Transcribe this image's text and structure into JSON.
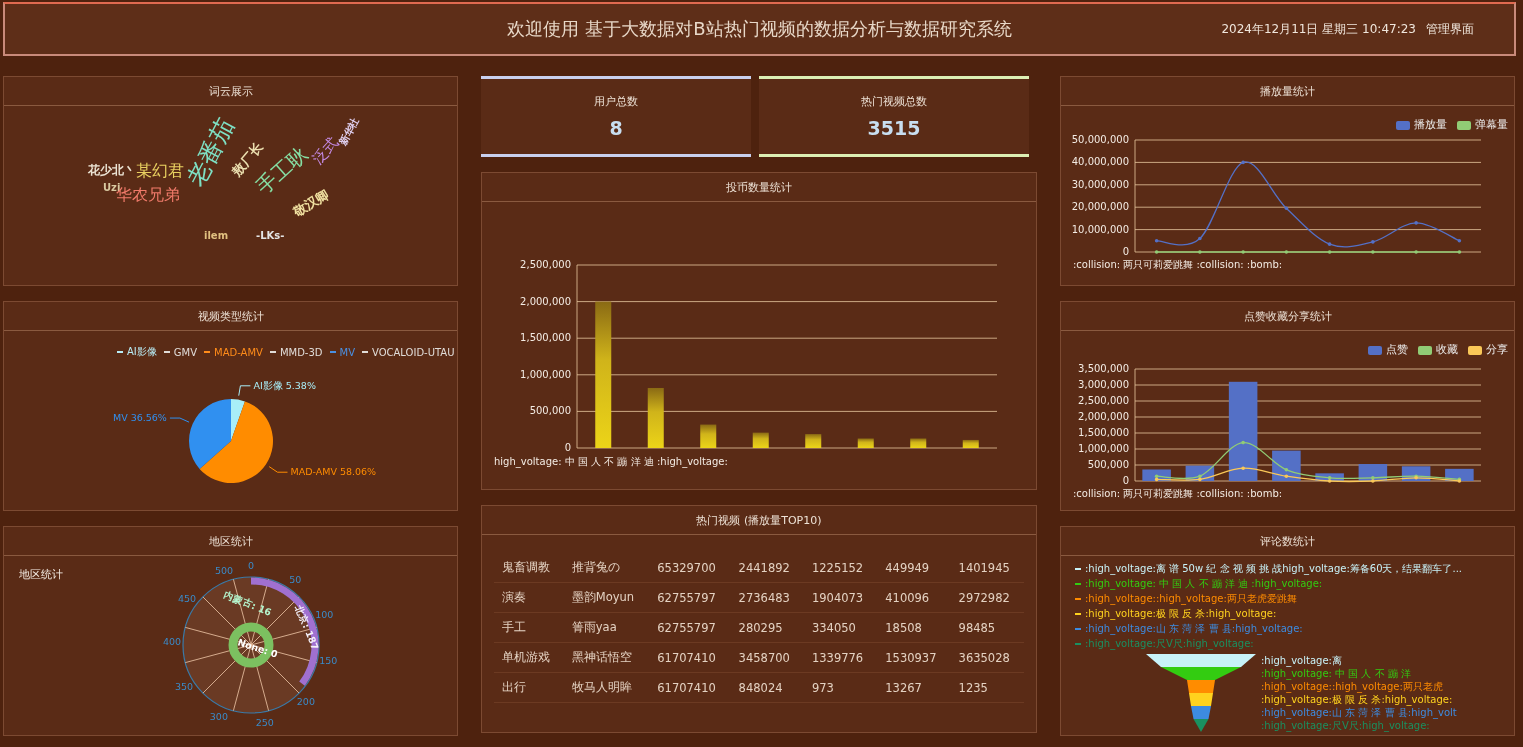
{
  "header": {
    "title": "欢迎使用 基于大数据对B站热门视频的数据分析与数据研究系统",
    "datetime": "2024年12月11日 星期三 10:47:23",
    "admin_link": "管理界面"
  },
  "word_cloud": {
    "title": "词云展示",
    "words": [
      {
        "text": "花少北丶",
        "color": "#ece4d4"
      },
      {
        "text": "Uzi",
        "color": "#d8c8a0"
      },
      {
        "text": "某幻君",
        "color": "#e8d060"
      },
      {
        "text": "华农兄弟",
        "color": "#f07a6a"
      },
      {
        "text": "老番茄",
        "color": "#7ee0c4"
      },
      {
        "text": "敖厂长",
        "color": "#ece0b0"
      },
      {
        "text": "手工耿",
        "color": "#86e0a4"
      },
      {
        "text": "泛式",
        "color": "#c48ae4"
      },
      {
        "text": "新华社",
        "color": "#e0d0f0"
      },
      {
        "text": "敬汉卿",
        "color": "#f0e0a0"
      },
      {
        "text": "ilem",
        "color": "#e0c080"
      },
      {
        "text": "-LKs-",
        "color": "#e4e4e4"
      }
    ]
  },
  "video_types": {
    "title": "视频类型统计",
    "legend": [
      {
        "label": "AI影像",
        "color": "#b8ecf5"
      },
      {
        "label": "GMV",
        "color": "#e0dcd8"
      },
      {
        "label": "MAD-AMV",
        "color": "#ff8c1a"
      },
      {
        "label": "MMD-3D",
        "color": "#e0dcd8"
      },
      {
        "label": "MV",
        "color": "#4a90e2"
      },
      {
        "label": "VOCALOID-UTAU",
        "color": "#e0dcd8"
      }
    ],
    "chart_data": {
      "type": "pie",
      "categories": [
        "AI影像",
        "MAD-AMV",
        "MV"
      ],
      "values": [
        5.38,
        58.06,
        36.56
      ],
      "colors": [
        "#a8eef8",
        "#ff8c00",
        "#3090f0"
      ],
      "value_labels": [
        "5.38%",
        "58.06%",
        "36.56%"
      ]
    }
  },
  "region": {
    "title": "地区统计",
    "chart_title": "地区统计",
    "axis_labels": [
      "0",
      "50",
      "100",
      "150",
      "200",
      "250",
      "300",
      "350",
      "400",
      "450",
      "500"
    ],
    "labels": [
      "内蒙古: 16",
      "北京: 187",
      "None: 0"
    ]
  },
  "stats": [
    {
      "label": "用户总数",
      "value": "8",
      "color": "#c9d0ee"
    },
    {
      "label": "热门视频总数",
      "value": "3515",
      "color": "#dcefb4"
    }
  ],
  "coins": {
    "title": "投币数量统计",
    "axis_caption": "high_voltage: 中 国 人 不 蹦 洋 迪 :high_voltage:",
    "chart_data": {
      "type": "bar",
      "grid": true,
      "values": [
        2000000,
        820000,
        320000,
        210000,
        190000,
        130000,
        130000,
        110000
      ],
      "ylim": [
        0,
        2500000
      ],
      "yticks": [
        0,
        {
          "value": 500000,
          "label": "500,000"
        },
        {
          "value": 1000000,
          "label": "1,000,000"
        },
        {
          "value": 1500000,
          "label": "1,500,000"
        },
        {
          "value": 2000000,
          "label": "2,000,000"
        },
        {
          "value": 2500000,
          "label": "2,500,000"
        }
      ]
    }
  },
  "hot_videos": {
    "title": "热门视频 (播放量TOP10)",
    "rows": [
      [
        "鬼畜调教",
        "推背兔の",
        "65329700",
        "2441892",
        "1225152",
        "449949",
        "1401945"
      ],
      [
        "演奏",
        "墨韵Moyun",
        "62755797",
        "2736483",
        "1904073",
        "410096",
        "2972982"
      ],
      [
        "手工",
        "箐雨yaa",
        "62755797",
        "280295",
        "334050",
        "18508",
        "98485"
      ],
      [
        "单机游戏",
        "黑神话悟空",
        "61707410",
        "3458700",
        "1339776",
        "1530937",
        "3635028"
      ],
      [
        "出行",
        "牧马人明眸",
        "61707410",
        "848024",
        "973",
        "13267",
        "1235"
      ]
    ]
  },
  "plays": {
    "title": "播放量统计",
    "axis_caption": ":collision: 两只可莉爱跳舞 :collision: :bomb:",
    "chart_data": {
      "type": "line",
      "grid": true,
      "ylim": [
        0,
        50000000
      ],
      "yticks": [
        0,
        {
          "value": 10000000,
          "label": "10,000,000"
        },
        {
          "value": 20000000,
          "label": "20,000,000"
        },
        {
          "value": 30000000,
          "label": "30,000,000"
        },
        {
          "value": 40000000,
          "label": "40,000,000"
        },
        {
          "value": 50000000,
          "label": "50,000,000"
        }
      ],
      "series": [
        {
          "name": "播放量",
          "color": "#5470c6",
          "values": [
            5000000,
            6000000,
            40000000,
            19500000,
            3500000,
            4500000,
            13000000,
            5000000
          ]
        },
        {
          "name": "弹幕量",
          "color": "#91cc75",
          "values": [
            0,
            0,
            0,
            0,
            0,
            0,
            0,
            0
          ]
        }
      ]
    }
  },
  "likes": {
    "title": "点赞收藏分享统计",
    "axis_caption": ":collision: 两只可莉爱跳舞 :collision: :bomb:",
    "chart_data": {
      "type": "bar",
      "grid": true,
      "ylim": [
        0,
        3500000
      ],
      "yticks": [
        0,
        {
          "value": 500000,
          "label": "500,000"
        },
        {
          "value": 1000000,
          "label": "1,000,000"
        },
        {
          "value": 1500000,
          "label": "1,500,000"
        },
        {
          "value": 2000000,
          "label": "2,000,000"
        },
        {
          "value": 2500000,
          "label": "2,500,000"
        },
        {
          "value": 3000000,
          "label": "3,000,000"
        },
        {
          "value": 3500000,
          "label": "3,500,000"
        }
      ],
      "series": [
        {
          "name": "点赞",
          "color": "#5470c6",
          "values": [
            360000,
            480000,
            3100000,
            950000,
            240000,
            530000,
            460000,
            380000
          ]
        },
        {
          "name": "收藏",
          "type": "line",
          "color": "#91cc75",
          "values": [
            150000,
            150000,
            1200000,
            350000,
            100000,
            100000,
            150000,
            50000
          ]
        },
        {
          "name": "分享",
          "type": "line",
          "color": "#fac858",
          "values": [
            50000,
            50000,
            400000,
            150000,
            0,
            0,
            100000,
            0
          ]
        }
      ]
    }
  },
  "comments": {
    "title": "评论数统计",
    "legend": [
      {
        "label": ":high_voltage:离 谱 50w 纪 念 视 频 挑 战high_voltage:筹备60天，结果翻车了...",
        "color": "#c8f2f8"
      },
      {
        "label": ":high_voltage: 中 国 人 不 蹦 洋 迪 :high_voltage:",
        "color": "#33cc11"
      },
      {
        "label": ":high_voltage::high_voltage:两只老虎爱跳舞",
        "color": "#ff8c00"
      },
      {
        "label": ":high_voltage:极 限 反 杀:high_voltage:",
        "color": "#ffd21e"
      },
      {
        "label": ":high_voltage:山 东 菏 泽 曹 县:high_voltage:",
        "color": "#3d8be0"
      },
      {
        "label": ":high_voltage:尺V尺:high_voltage:",
        "color": "#1a9060"
      }
    ],
    "funnel_labels": [
      ":high_voltage:离",
      ":high_voltage: 中 国 人 不 蹦 洋",
      ":high_voltage::high_voltage:两只老虎",
      ":high_voltage:极 限 反 杀:high_voltage:",
      ":high_voltage:山 东 菏 泽 曹 县:high_volt",
      ":high_voltage:尺V尺:high_voltage:"
    ]
  }
}
